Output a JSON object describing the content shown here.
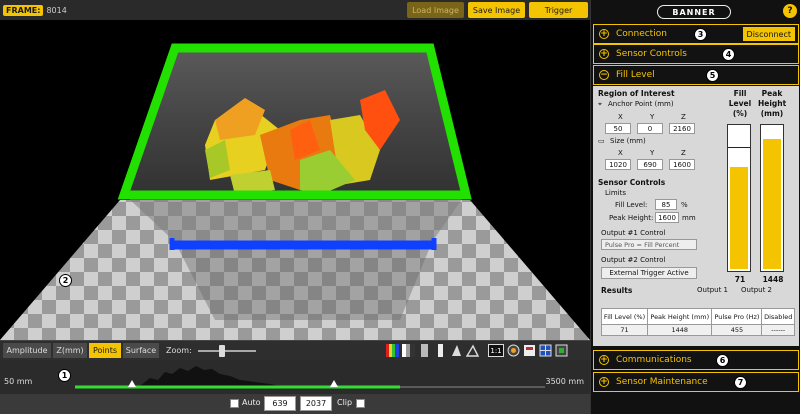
{
  "topbar": {
    "frame_label": "FRAME:",
    "frame_number": "8014",
    "load_image": "Load Image",
    "save_image": "Save Image",
    "trigger": "Trigger"
  },
  "callouts": [
    "1",
    "2",
    "3",
    "4",
    "5",
    "6",
    "7"
  ],
  "toolbar": {
    "tabs": [
      "Amplitude",
      "Z(mm)",
      "Points",
      "Surface"
    ],
    "active_tab": "Points",
    "zoom_label": "Zoom:",
    "zoom_level": 0.4,
    "ratio_label": "1:1"
  },
  "histogram": {
    "min_label": "50 mm",
    "max_label": "3500 mm"
  },
  "range": {
    "auto_label": "Auto",
    "min_value": "639",
    "max_value": "2037",
    "clip_label": "Clip"
  },
  "panel": {
    "logo": "BANNER",
    "help": "?",
    "sections": {
      "connection": "Connection",
      "disconnect": "Disconnect",
      "sensor_controls": "Sensor Controls",
      "fill_level": "Fill Level",
      "communications": "Communications",
      "sensor_maintenance": "Sensor Maintenance"
    },
    "fill": {
      "roi_title": "Region of Interest",
      "anchor_label": "Anchor Point (mm)",
      "axes": [
        "X",
        "Y",
        "Z"
      ],
      "anchor_values": [
        "50",
        "0",
        "2160"
      ],
      "size_label": "Size (mm)",
      "size_values": [
        "1020",
        "690",
        "1600"
      ],
      "sensor_controls_title": "Sensor Controls",
      "limits_label": "Limits",
      "fill_level_label": "Fill Level:",
      "fill_level_value": "85",
      "fill_level_unit": "%",
      "peak_height_label": "Peak Height:",
      "peak_height_value": "1600",
      "peak_height_unit": "mm",
      "output1_label": "Output #1 Control",
      "output1_value": "Pulse Pro = Fill Percent",
      "output2_label": "Output #2 Control",
      "output2_value": "External Trigger Active",
      "results_label": "Results",
      "output1_header": "Output 1",
      "output2_header": "Output 2",
      "gauge_fill_title": "Fill Level (%)",
      "gauge_fill_title_lines": [
        "Fill",
        "Level",
        "(%)"
      ],
      "gauge_peak_title_lines": [
        "Peak",
        "Height",
        "(mm)"
      ],
      "gauge_fill_value": "71",
      "gauge_peak_value": "1448",
      "gauge_fill_fraction": 0.71,
      "gauge_peak_fraction": 0.905,
      "table_headers": [
        "Fill Level (%)",
        "Peak Height (mm)",
        "Pulse Pro (Hz)",
        "Disabled"
      ],
      "table_values": [
        "71",
        "1448",
        "455",
        "------"
      ]
    }
  },
  "colors": {
    "accent": "#f5c400",
    "roi_green": "#22e000",
    "roi_blue": "#1040ff"
  }
}
